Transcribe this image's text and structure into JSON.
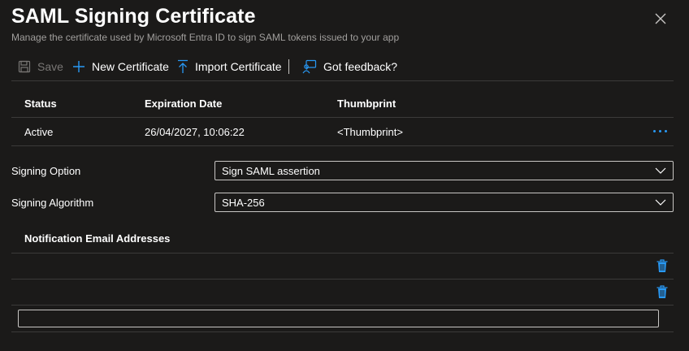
{
  "header": {
    "title": "SAML Signing Certificate",
    "subtitle": "Manage the certificate used by Microsoft Entra ID to sign SAML tokens issued to your app"
  },
  "toolbar": {
    "save": "Save",
    "new_certificate": "New Certificate",
    "import_certificate": "Import Certificate",
    "feedback": "Got feedback?"
  },
  "certificate_table": {
    "columns": [
      "Status",
      "Expiration Date",
      "Thumbprint"
    ],
    "rows": [
      {
        "status": "Active",
        "expiration": "26/04/2027, 10:06:22",
        "thumbprint": "<Thumbprint>"
      }
    ]
  },
  "signing_option": {
    "label": "Signing Option",
    "value": "Sign SAML assertion"
  },
  "signing_algorithm": {
    "label": "Signing Algorithm",
    "value": "SHA-256"
  },
  "notifications": {
    "title": "Notification Email Addresses",
    "emails": [
      "",
      ""
    ],
    "new_email_value": ""
  },
  "colors": {
    "background": "#1b1a19",
    "accent": "#2899f5",
    "divider": "#3b3a39"
  }
}
